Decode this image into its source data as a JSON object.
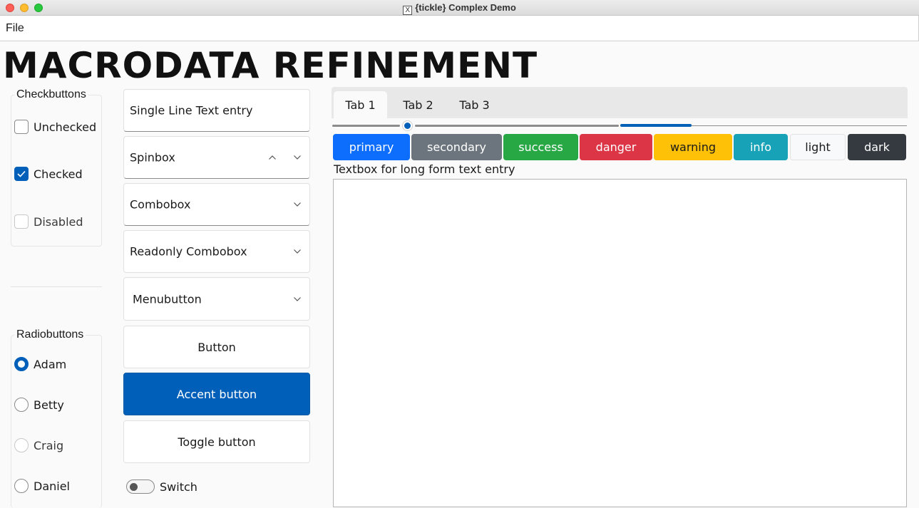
{
  "window": {
    "title": "{tickle} Complex Demo",
    "app_icon_glyph": "X"
  },
  "menubar": {
    "file_label": "File"
  },
  "heading": "MACRODATA REFINEMENT",
  "checkbuttons": {
    "title": "Checkbuttons",
    "items": [
      {
        "label": "Unchecked",
        "state": "unchecked"
      },
      {
        "label": "Checked",
        "state": "checked"
      },
      {
        "label": "Disabled",
        "state": "disabled"
      }
    ]
  },
  "radiobuttons": {
    "title": "Radiobuttons",
    "items": [
      {
        "label": "Adam",
        "state": "selected"
      },
      {
        "label": "Betty",
        "state": "unselected"
      },
      {
        "label": "Craig",
        "state": "disabled"
      },
      {
        "label": "Daniel",
        "state": "unselected"
      }
    ]
  },
  "widgets": {
    "entry_value": "Single Line Text entry",
    "spinbox_value": "Spinbox",
    "combobox_value": "Combobox",
    "readonly_combobox_value": "Readonly Combobox",
    "menubutton_label": "Menubutton",
    "button_label": "Button",
    "accent_button_label": "Accent button",
    "toggle_button_label": "Toggle button",
    "switch_label": "Switch",
    "switch_on": false
  },
  "notebook": {
    "tabs": [
      {
        "label": "Tab 1",
        "active": true
      },
      {
        "label": "Tab 2",
        "active": false
      },
      {
        "label": "Tab 3",
        "active": false
      }
    ],
    "slider_value_fraction": 0.26,
    "progress_fraction": 0.25
  },
  "color_buttons": [
    {
      "label": "primary",
      "bg": "#0d6efd",
      "fg": "#ffffff"
    },
    {
      "label": "secondary",
      "bg": "#6c757d",
      "fg": "#ffffff"
    },
    {
      "label": "success",
      "bg": "#28a745",
      "fg": "#ffffff"
    },
    {
      "label": "danger",
      "bg": "#dc3545",
      "fg": "#ffffff"
    },
    {
      "label": "warning",
      "bg": "#ffc107",
      "fg": "#1a1a1a"
    },
    {
      "label": "info",
      "bg": "#17a2b8",
      "fg": "#ffffff"
    },
    {
      "label": "light",
      "bg": "#f8f9fa",
      "fg": "#1a1a1a"
    },
    {
      "label": "dark",
      "bg": "#343a40",
      "fg": "#ffffff"
    }
  ],
  "textbox": {
    "label": "Textbox for long form text entry",
    "value": ""
  },
  "colors": {
    "accent": "#005fb8"
  }
}
